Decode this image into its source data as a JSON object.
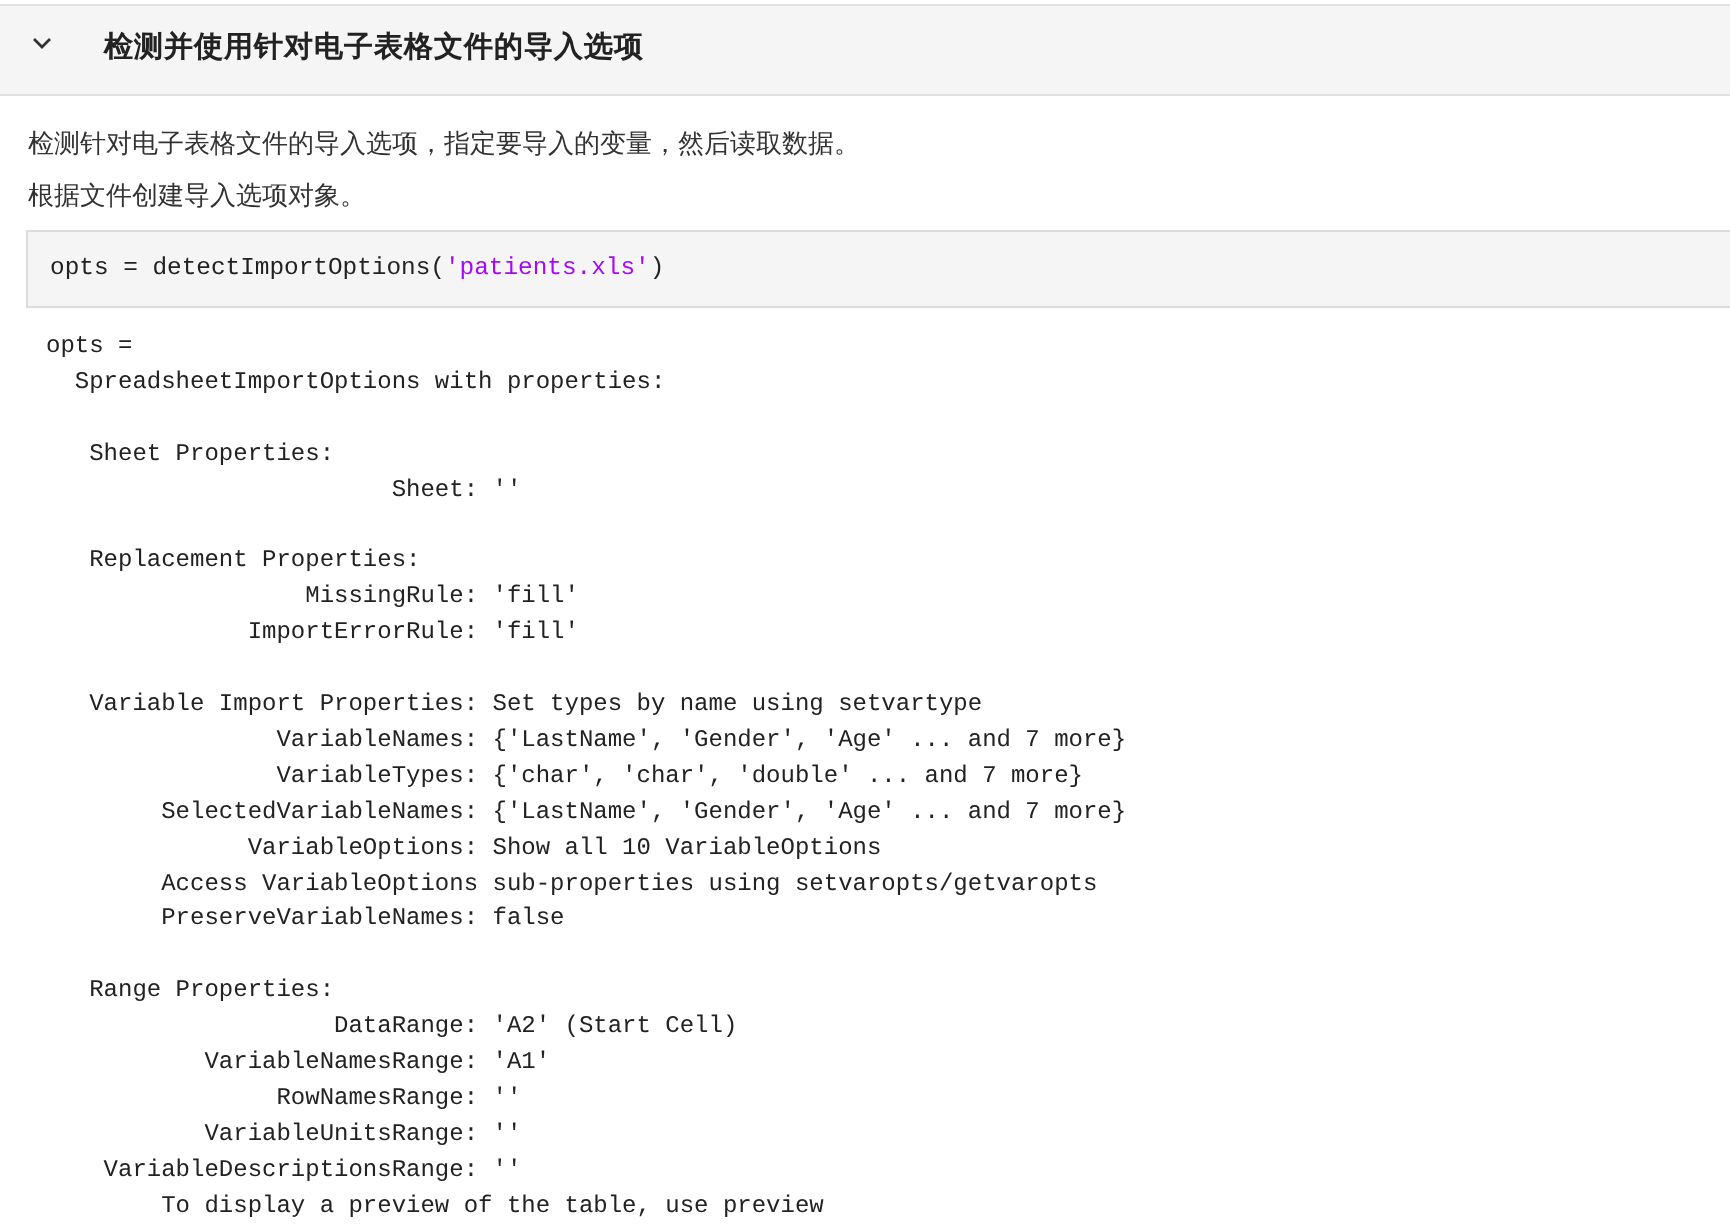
{
  "section": {
    "title": "检测并使用针对电子表格文件的导入选项",
    "expanded": true
  },
  "paragraphs": [
    "检测针对电子表格文件的导入选项，指定要导入的变量，然后读取数据。",
    "根据文件创建导入选项对象。"
  ],
  "code": [
    {
      "kind": "plain",
      "text": "opts = detectImportOptions("
    },
    {
      "kind": "string",
      "text": "'patients.xls'"
    },
    {
      "kind": "plain",
      "text": ")"
    }
  ],
  "output": [
    [
      "opts =",
      "  SpreadsheetImportOptions with properties:"
    ],
    [
      "   Sheet Properties:",
      "                        Sheet: ''"
    ],
    [
      "   Replacement Properties:",
      "                  MissingRule: 'fill'",
      "              ImportErrorRule: 'fill'"
    ],
    [
      "   Variable Import Properties: Set types by name using setvartype",
      "                VariableNames: {'LastName', 'Gender', 'Age' ... and 7 more}",
      "                VariableTypes: {'char', 'char', 'double' ... and 7 more}",
      "        SelectedVariableNames: {'LastName', 'Gender', 'Age' ... and 7 more}",
      "              VariableOptions: Show all 10 VariableOptions",
      "        Access VariableOptions sub-properties using setvaropts/getvaropts",
      "        PreserveVariableNames: false"
    ],
    [
      "   Range Properties:",
      "                    DataRange: 'A2' (Start Cell)",
      "           VariableNamesRange: 'A1'",
      "                RowNamesRange: ''",
      "           VariableUnitsRange: ''",
      "    VariableDescriptionsRange: ''",
      "        To display a preview of the table, use preview"
    ]
  ]
}
